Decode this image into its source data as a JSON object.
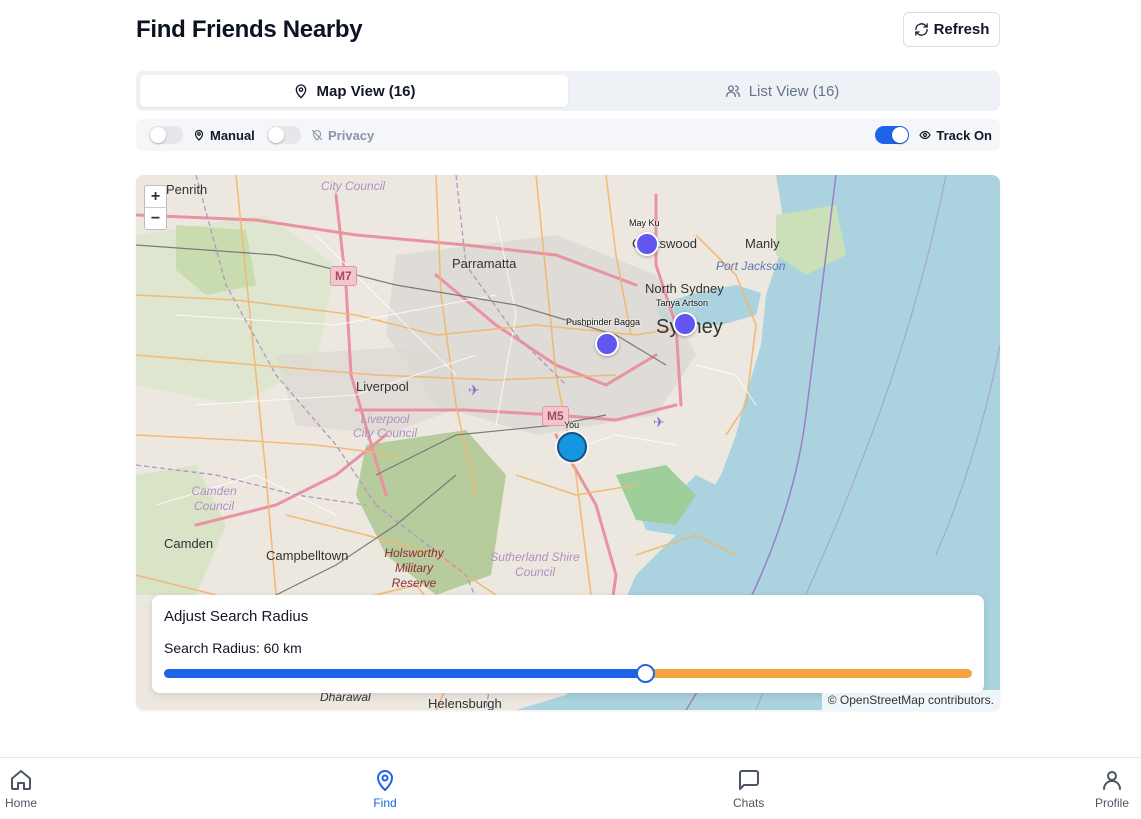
{
  "header": {
    "title": "Find Friends Nearby",
    "refresh_label": "Refresh"
  },
  "tabs": [
    {
      "label": "Map View (16)",
      "icon": "map-pin-icon",
      "active": true
    },
    {
      "label": "List View (16)",
      "icon": "users-icon",
      "active": false
    }
  ],
  "controls": {
    "manual": {
      "label": "Manual",
      "on": false
    },
    "privacy": {
      "label": "Privacy",
      "on": false
    },
    "track": {
      "label": "Track On",
      "on": true
    }
  },
  "map": {
    "zoom_in": "+",
    "zoom_out": "−",
    "attribution": "© OpenStreetMap contributors.",
    "place_labels": [
      "Penrith",
      "City Council",
      "Parramatta",
      "Chatswood",
      "Manly",
      "Port Jackson",
      "North Sydney",
      "Sydney",
      "Liverpool",
      "Liverpool City Council",
      "Camden Council",
      "Camden",
      "Campbelltown",
      "Holsworthy Military Reserve",
      "Sutherland Shire Council",
      "Dharawal",
      "Helensburgh",
      "M7",
      "M5"
    ],
    "friends": [
      {
        "name": "May Ku"
      },
      {
        "name": "Tanya Artson"
      },
      {
        "name": "Pushpinder Bagga"
      }
    ],
    "me_label": "You"
  },
  "radius": {
    "title": "Adjust Search Radius",
    "value_text": "Search Radius: 60 km",
    "value_km": 60,
    "fraction": 0.595
  },
  "nav": [
    {
      "label": "Home",
      "icon": "home-icon",
      "active": false
    },
    {
      "label": "Find",
      "icon": "map-pin-icon",
      "active": true
    },
    {
      "label": "Chats",
      "icon": "chat-icon",
      "active": false
    },
    {
      "label": "Profile",
      "icon": "user-icon",
      "active": false
    }
  ],
  "colors": {
    "accent": "#1d64e8",
    "friend_pin": "#6156f0",
    "me_pin": "#1696e0",
    "slider_track": "#f4a13f",
    "water": "#aad3df"
  }
}
